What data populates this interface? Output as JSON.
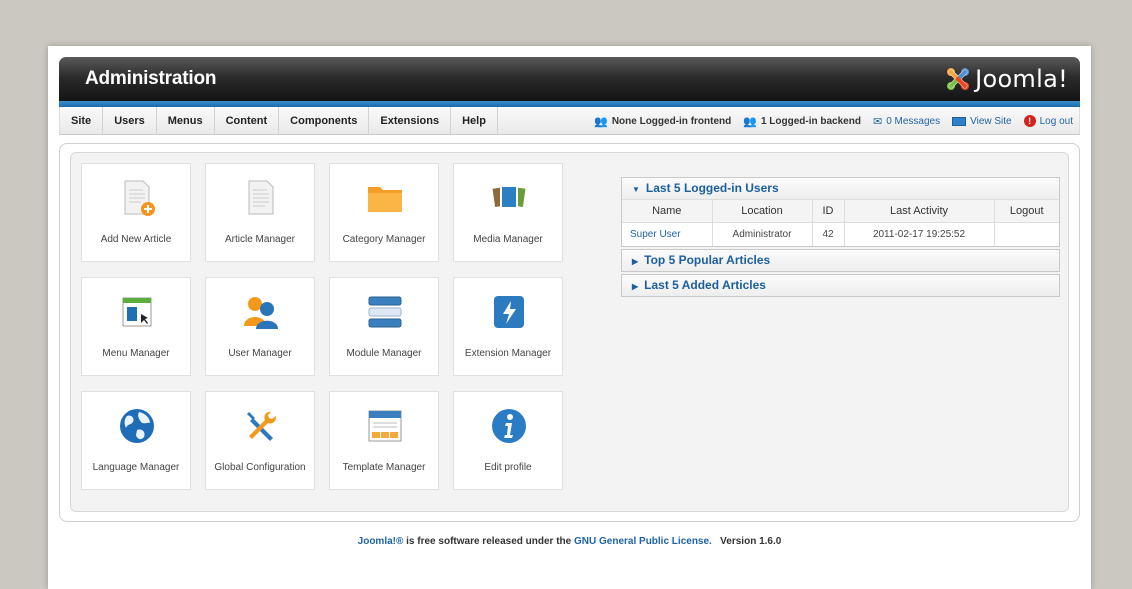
{
  "header": {
    "title": "Administration",
    "logo_text": "Joomla!"
  },
  "menu": [
    "Site",
    "Users",
    "Menus",
    "Content",
    "Components",
    "Extensions",
    "Help"
  ],
  "status": {
    "frontend": "None Logged-in frontend",
    "backend": "1 Logged-in backend",
    "messages": "0 Messages",
    "view_site": "View Site",
    "logout": "Log out"
  },
  "quick_icons": [
    {
      "label": "Add New Article",
      "icon": "add-article-icon"
    },
    {
      "label": "Article Manager",
      "icon": "article-icon"
    },
    {
      "label": "Category Manager",
      "icon": "folder-icon"
    },
    {
      "label": "Media Manager",
      "icon": "media-icon"
    },
    {
      "label": "Menu Manager",
      "icon": "menu-icon"
    },
    {
      "label": "User Manager",
      "icon": "users-icon"
    },
    {
      "label": "Module Manager",
      "icon": "module-icon"
    },
    {
      "label": "Extension Manager",
      "icon": "extension-icon"
    },
    {
      "label": "Language Manager",
      "icon": "globe-icon"
    },
    {
      "label": "Global Configuration",
      "icon": "tools-icon"
    },
    {
      "label": "Template Manager",
      "icon": "template-icon"
    },
    {
      "label": "Edit profile",
      "icon": "info-icon"
    }
  ],
  "panels": {
    "logged_in": {
      "title": "Last 5 Logged-in Users",
      "columns": [
        "Name",
        "Location",
        "ID",
        "Last Activity",
        "Logout"
      ],
      "rows": [
        [
          "Super User",
          "Administrator",
          "42",
          "2011-02-17 19:25:52",
          ""
        ]
      ]
    },
    "popular": {
      "title": "Top 5 Popular Articles"
    },
    "added": {
      "title": "Last 5 Added Articles"
    }
  },
  "footer": {
    "brand": "Joomla!®",
    "text": " is free software released under the ",
    "license": "GNU General Public License.",
    "version": "Version 1.6.0"
  },
  "colors": {
    "accent_blue": "#1b5f9e",
    "header_dark": "#1a1a1a",
    "bar_blue": "#2f7fc9"
  }
}
